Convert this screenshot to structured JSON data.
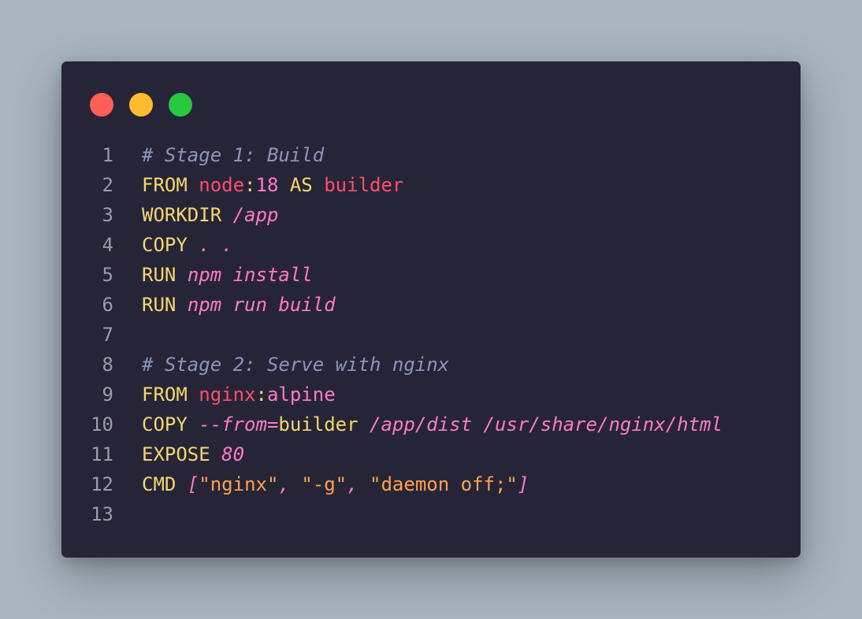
{
  "window": {
    "controls": [
      "close",
      "minimize",
      "maximize"
    ]
  },
  "lines": [
    {
      "n": "1",
      "tokens": [
        {
          "t": "# Stage 1: Build",
          "c": "comment"
        }
      ]
    },
    {
      "n": "2",
      "tokens": [
        {
          "t": "FROM",
          "c": "kw"
        },
        {
          "t": " ",
          "c": "plain"
        },
        {
          "t": "node",
          "c": "img"
        },
        {
          "t": ":",
          "c": "punct"
        },
        {
          "t": "18",
          "c": "tag"
        },
        {
          "t": " ",
          "c": "plain"
        },
        {
          "t": "AS",
          "c": "kw"
        },
        {
          "t": " ",
          "c": "plain"
        },
        {
          "t": "builder",
          "c": "img"
        }
      ]
    },
    {
      "n": "3",
      "tokens": [
        {
          "t": "WORKDIR",
          "c": "kw"
        },
        {
          "t": " ",
          "c": "plain"
        },
        {
          "t": "/app",
          "c": "it"
        }
      ]
    },
    {
      "n": "4",
      "tokens": [
        {
          "t": "COPY",
          "c": "kw"
        },
        {
          "t": " ",
          "c": "plain"
        },
        {
          "t": ". .",
          "c": "it"
        }
      ]
    },
    {
      "n": "5",
      "tokens": [
        {
          "t": "RUN",
          "c": "kw"
        },
        {
          "t": " ",
          "c": "plain"
        },
        {
          "t": "npm install",
          "c": "it"
        }
      ]
    },
    {
      "n": "6",
      "tokens": [
        {
          "t": "RUN",
          "c": "kw"
        },
        {
          "t": " ",
          "c": "plain"
        },
        {
          "t": "npm run build",
          "c": "it"
        }
      ]
    },
    {
      "n": "7",
      "tokens": []
    },
    {
      "n": "8",
      "tokens": [
        {
          "t": "# Stage 2: Serve with nginx",
          "c": "comment"
        }
      ]
    },
    {
      "n": "9",
      "tokens": [
        {
          "t": "FROM",
          "c": "kw"
        },
        {
          "t": " ",
          "c": "plain"
        },
        {
          "t": "nginx",
          "c": "img"
        },
        {
          "t": ":",
          "c": "punct"
        },
        {
          "t": "alpine",
          "c": "tag"
        }
      ]
    },
    {
      "n": "10",
      "tokens": [
        {
          "t": "COPY",
          "c": "kw"
        },
        {
          "t": " ",
          "c": "plain"
        },
        {
          "t": "--from",
          "c": "fromflag"
        },
        {
          "t": "=",
          "c": "eq"
        },
        {
          "t": "builder",
          "c": "ident"
        },
        {
          "t": " ",
          "c": "plain"
        },
        {
          "t": "/app/dist /usr/share/nginx/html",
          "c": "it"
        }
      ]
    },
    {
      "n": "11",
      "tokens": [
        {
          "t": "EXPOSE",
          "c": "kw"
        },
        {
          "t": " ",
          "c": "plain"
        },
        {
          "t": "80",
          "c": "it"
        }
      ]
    },
    {
      "n": "12",
      "tokens": [
        {
          "t": "CMD",
          "c": "kw"
        },
        {
          "t": " ",
          "c": "plain"
        },
        {
          "t": "[",
          "c": "bracket"
        },
        {
          "t": "\"nginx\"",
          "c": "str"
        },
        {
          "t": ", ",
          "c": "bracket"
        },
        {
          "t": "\"-g\"",
          "c": "str"
        },
        {
          "t": ", ",
          "c": "bracket"
        },
        {
          "t": "\"daemon off;\"",
          "c": "str"
        },
        {
          "t": "]",
          "c": "bracket"
        }
      ]
    },
    {
      "n": "13",
      "tokens": []
    }
  ],
  "colors": {
    "background": "#a9b4bf",
    "window": "#262537",
    "close": "#ff5f57",
    "minimize": "#febc2e",
    "maximize": "#28c840",
    "keyword": "#f5d76e",
    "comment": "#8a95bd",
    "image": "#ff4d6a",
    "pink": "#ff79c6",
    "string": "#ffa24f",
    "line_number": "#9a9aa8"
  }
}
